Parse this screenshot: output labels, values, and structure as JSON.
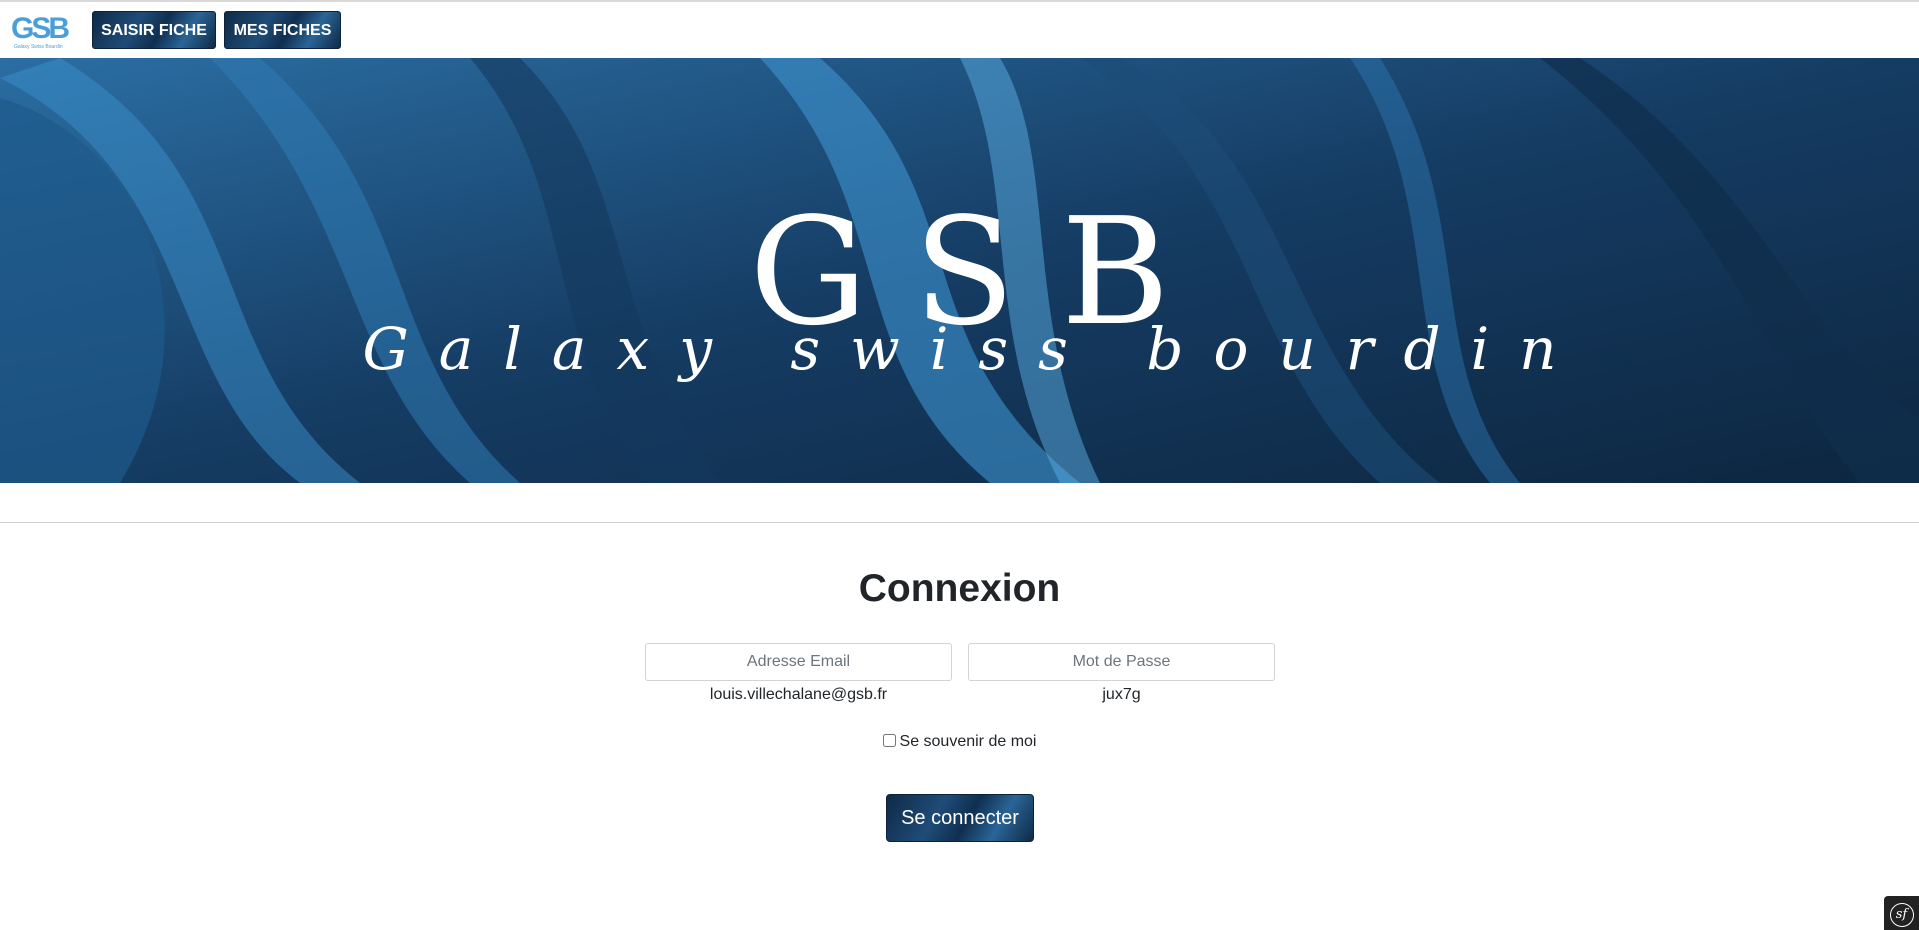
{
  "navbar": {
    "logo_text": "GSB",
    "logo_tagline": "Galaxy Swiss Bourdin",
    "buttons": [
      "SAISIR FICHE",
      "MES FICHES"
    ]
  },
  "hero": {
    "title": "GSB",
    "subtitle": "Galaxy swiss bourdin"
  },
  "login": {
    "title": "Connexion",
    "email_placeholder": "Adresse Email",
    "email_hint": "louis.villechalane@gsb.fr",
    "password_placeholder": "Mot de Passe",
    "password_hint": "jux7g",
    "remember_label": "Se souvenir de moi",
    "remember_checked": false,
    "submit_label": "Se connecter"
  },
  "toolbar": {
    "symfony_label": "sf"
  },
  "colors": {
    "brand_dark": "#0f2a47",
    "brand_mid": "#1f4c78",
    "brand_light": "#4a9fd8"
  }
}
